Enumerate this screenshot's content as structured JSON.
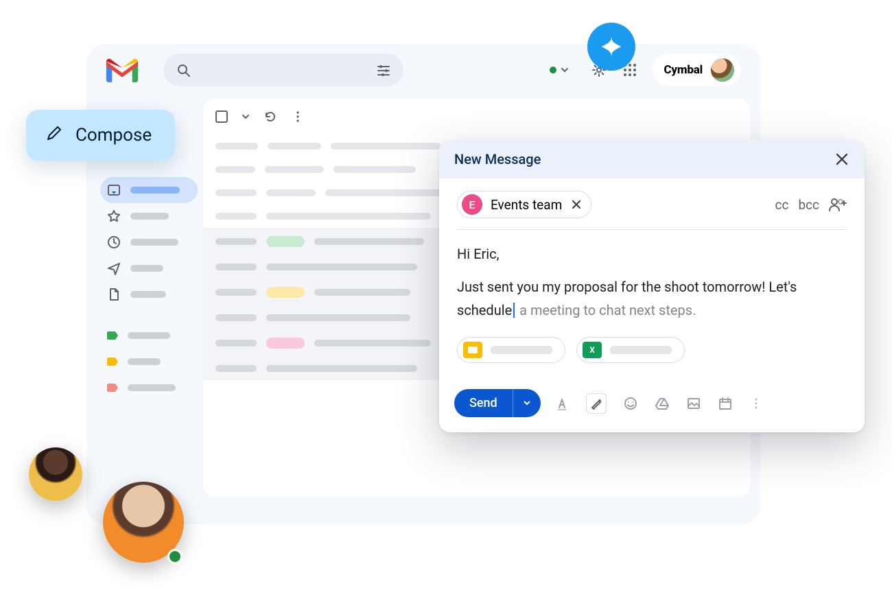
{
  "header": {
    "workspace_name": "Cymbal"
  },
  "compose_button": {
    "label": "Compose"
  },
  "sidebar": {
    "items": [
      {
        "icon": "inbox-icon",
        "active": true
      },
      {
        "icon": "star-icon",
        "active": false
      },
      {
        "icon": "clock-icon",
        "active": false
      },
      {
        "icon": "sent-icon",
        "active": false
      },
      {
        "icon": "file-icon",
        "active": false
      }
    ],
    "labels": [
      {
        "color": "#34a853"
      },
      {
        "color": "#fbbc04"
      },
      {
        "color": "#f28b82"
      }
    ]
  },
  "compose_dialog": {
    "title": "New Message",
    "recipient": {
      "initial": "E",
      "name": "Events team"
    },
    "cc_label": "cc",
    "bcc_label": "bcc",
    "body_line1": "Hi Eric,",
    "body_line2_typed": "Just sent you my proposal for the shoot tomorrow! Let's schedule",
    "body_line2_suggestion": " a meeting to chat next steps.",
    "attachments": [
      {
        "type": "slides",
        "icon_color": "#fbbc04"
      },
      {
        "type": "sheets",
        "icon_color": "#0f9d58",
        "icon_label": "X"
      }
    ],
    "send_label": "Send"
  }
}
